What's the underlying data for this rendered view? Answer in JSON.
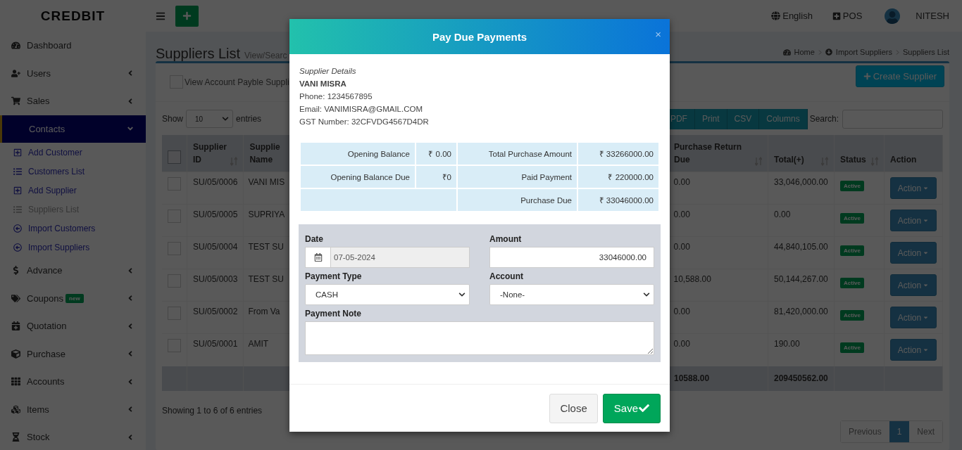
{
  "header": {
    "logo": "CREDBIT",
    "language": "English",
    "pos": "POS",
    "user": "NITESH"
  },
  "sidebar": {
    "items": [
      {
        "label": "Dashboard",
        "has_submenu": false,
        "selected": false
      },
      {
        "label": "Users",
        "has_submenu": true,
        "expanded": false,
        "selected": false
      },
      {
        "label": "Sales",
        "has_submenu": true,
        "expanded": false,
        "selected": false
      },
      {
        "label": "Contacts",
        "has_submenu": true,
        "expanded": true,
        "selected": true,
        "children": [
          {
            "label": "Add Customer",
            "selected": false
          },
          {
            "label": "Customers List",
            "selected": false
          },
          {
            "label": "Add Supplier",
            "selected": false
          },
          {
            "label": "Suppliers List",
            "selected": true
          },
          {
            "label": "Import Customers",
            "selected": false
          },
          {
            "label": "Import Suppliers",
            "selected": false
          }
        ]
      },
      {
        "label": "Advance",
        "has_submenu": true,
        "expanded": false,
        "selected": false
      },
      {
        "label": "Coupons",
        "has_submenu": true,
        "expanded": false,
        "selected": false,
        "badge": "new"
      },
      {
        "label": "Quotation",
        "has_submenu": true,
        "expanded": false,
        "selected": false
      },
      {
        "label": "Purchase",
        "has_submenu": true,
        "expanded": false,
        "selected": false
      },
      {
        "label": "Accounts",
        "has_submenu": true,
        "expanded": false,
        "selected": false
      },
      {
        "label": "Items",
        "has_submenu": true,
        "expanded": false,
        "selected": false
      },
      {
        "label": "Stock",
        "has_submenu": true,
        "expanded": false,
        "selected": false
      }
    ]
  },
  "page": {
    "title": "Suppliers List",
    "subtitle": "View/Searc",
    "breadcrumb": [
      "Home",
      "Import Suppliers",
      "Suppliers List"
    ],
    "filter": {
      "label": "View Account Payble Suppli",
      "checked": false
    },
    "create_button": "Create Supplier",
    "length": {
      "show": "Show",
      "value": "10",
      "entries": "entries"
    },
    "export_buttons": [
      "PDF",
      "Print",
      "CSV",
      "Columns"
    ],
    "search_label": "Search:",
    "table": {
      "select_all": {
        "checked": false
      },
      "columns": [
        {
          "label": "Supplier ID",
          "sortable": true
        },
        {
          "label": "Supplie Name"
        },
        {
          "label": "Purchase Return Due",
          "sortable": true
        },
        {
          "label": "Total(+)",
          "sortable": true
        },
        {
          "label": "Status",
          "sortable": true
        },
        {
          "label": "Action",
          "sortable": false
        }
      ],
      "rows": [
        {
          "checked": false,
          "id": "SU/05/0006",
          "name": "VANI MIS",
          "purchase_return_due": "0.00",
          "total": "33,046,000.00",
          "status": "Active",
          "action": "Action"
        },
        {
          "checked": false,
          "id": "SU/05/0005",
          "name": "SUPRIYA",
          "purchase_return_due": "0.00",
          "total": "0.00",
          "status": "Active",
          "action": "Action"
        },
        {
          "checked": false,
          "id": "SU/05/0004",
          "name": "TEST SU",
          "purchase_return_due": "0.00",
          "total": "44,840,105.00",
          "status": "Active",
          "action": "Action"
        },
        {
          "checked": false,
          "id": "SU/05/0003",
          "name": "TEST SU",
          "purchase_return_due": "10,588.00",
          "total": "50,144,267.00",
          "status": "Active",
          "action": "Action"
        },
        {
          "checked": false,
          "id": "SU/05/0002",
          "name": "From Va",
          "purchase_return_due": "0.00",
          "total": "81,420,000.00",
          "status": "Active",
          "action": "Action"
        },
        {
          "checked": false,
          "id": "SU/05/0001",
          "name": "AMIT",
          "purchase_return_due": "0.00",
          "total": "190.00",
          "status": "Active",
          "action": "Action"
        }
      ],
      "totals": {
        "purchase_return_due": "10588.00",
        "total": "209450562.00"
      }
    },
    "info": "Showing 1 to 6 of 6 entries",
    "pagination": [
      {
        "label": "Previous",
        "selected": false
      },
      {
        "label": "1",
        "selected": true
      },
      {
        "label": "Next",
        "selected": false
      }
    ]
  },
  "modal": {
    "title": "Pay Due Payments",
    "close": "×",
    "supplier": {
      "caption": "Supplier Details",
      "name": "VANI MISRA",
      "lines": [
        "Phone: 1234567895",
        "Email: VANIMISRA@GMAIL.COM",
        "GST Number: 32CFVDG4567D4DR"
      ]
    },
    "summary": {
      "left": [
        {
          "label": "Opening Balance",
          "value": "₹ 0.00"
        },
        {
          "label": "Opening Balance Due",
          "value": "₹0"
        }
      ],
      "right": [
        {
          "label": "Total Purchase Amount",
          "value": "₹ 33266000.00"
        },
        {
          "label": "Paid Payment",
          "value": "₹ 220000.00"
        },
        {
          "label": "Purchase Due",
          "value": "₹ 33046000.00"
        }
      ]
    },
    "form": {
      "date": {
        "label": "Date",
        "value": "07-05-2024"
      },
      "amount": {
        "label": "Amount",
        "value": "33046000.00"
      },
      "payment_type": {
        "label": "Payment Type",
        "value": "CASH"
      },
      "account": {
        "label": "Account",
        "value": "-None-"
      },
      "note": {
        "label": "Payment Note"
      }
    },
    "buttons": {
      "close": "Close",
      "save": "Save"
    }
  }
}
